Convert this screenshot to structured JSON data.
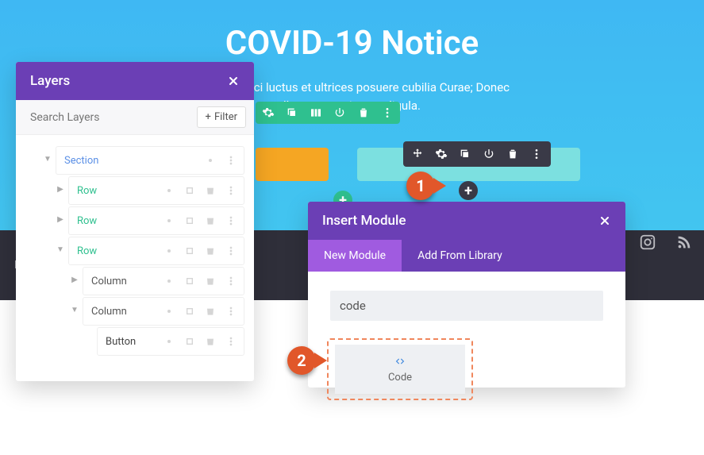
{
  "hero": {
    "title": "COVID-19 Notice",
    "subtitle_line1": "faucibus orci luctus et ultrices posuere cubilia Curae; Donec",
    "subtitle_line2": "llamcorper sit amet ligula."
  },
  "footer": {
    "text": "dPress"
  },
  "layers_panel": {
    "title": "Layers",
    "search_placeholder": "Search Layers",
    "filter_label": "Filter",
    "tree": [
      {
        "name": "Section",
        "type": "sec",
        "indent": 0,
        "expanded": true
      },
      {
        "name": "Row",
        "type": "row",
        "indent": 1,
        "expanded": false
      },
      {
        "name": "Row",
        "type": "row",
        "indent": 1,
        "expanded": false
      },
      {
        "name": "Row",
        "type": "row",
        "indent": 1,
        "expanded": true
      },
      {
        "name": "Column",
        "type": "col",
        "indent": 2,
        "expanded": false
      },
      {
        "name": "Column",
        "type": "col",
        "indent": 2,
        "expanded": true
      },
      {
        "name": "Button",
        "type": "btn",
        "indent": 3,
        "expanded": null
      }
    ]
  },
  "insert_panel": {
    "title": "Insert Module",
    "tab_new": "New Module",
    "tab_lib": "Add From Library",
    "search_value": "code",
    "module_name": "Code"
  },
  "annotations": {
    "one": "1",
    "two": "2"
  }
}
